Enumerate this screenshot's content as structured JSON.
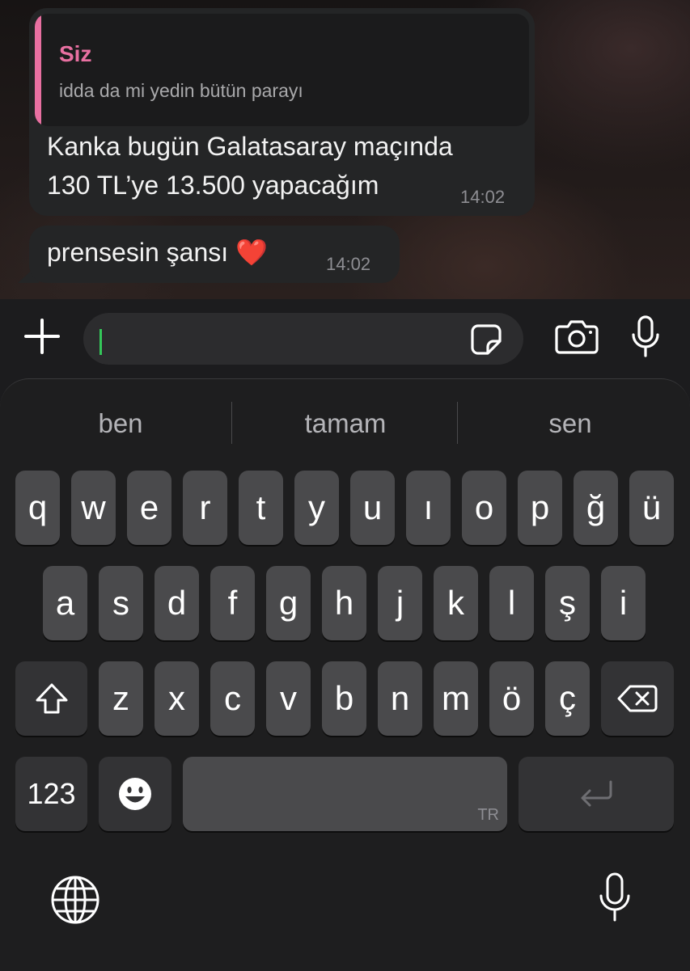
{
  "chat": {
    "message1": {
      "quote_author": "Siz",
      "quote_text": "idda da mi yedin bütün parayı",
      "line1": "Kanka bugün Galatasaray maçında",
      "line2": "130 TL’ye 13.500 yapacağım",
      "time": "14:02"
    },
    "message2": {
      "text": "prensesin şansı ❤️",
      "time": "14:02"
    }
  },
  "compose": {
    "icons": [
      "plus-icon",
      "sticker-icon",
      "camera-icon",
      "microphone-icon"
    ],
    "input_value": ""
  },
  "keyboard": {
    "suggestions": [
      "ben",
      "tamam",
      "sen"
    ],
    "row1": [
      "q",
      "w",
      "e",
      "r",
      "t",
      "y",
      "u",
      "ı",
      "o",
      "p",
      "ğ",
      "ü"
    ],
    "row2": [
      "a",
      "s",
      "d",
      "f",
      "g",
      "h",
      "j",
      "k",
      "l",
      "ş",
      "i"
    ],
    "row3": [
      "z",
      "x",
      "c",
      "v",
      "b",
      "n",
      "m",
      "ö",
      "ç"
    ],
    "numbers_key": "123",
    "space_language": "TR",
    "icons": [
      "shift-icon",
      "backspace-icon",
      "emoji-icon",
      "return-icon",
      "globe-icon",
      "dictation-microphone-icon"
    ]
  },
  "colors": {
    "quote_accent": "#e870a1",
    "caret": "#34c759",
    "bubble": "#242526",
    "key": "#4a4a4c",
    "key_dark": "#333335"
  }
}
